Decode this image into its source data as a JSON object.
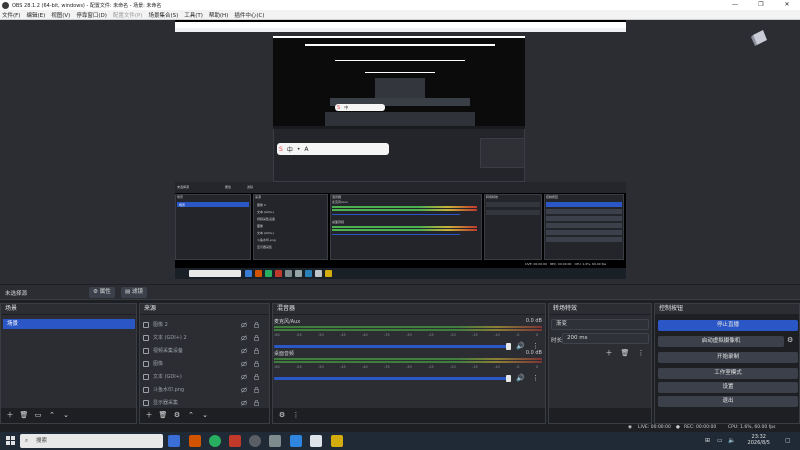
{
  "window": {
    "title": "OBS 28.1.2 (64-bit, windows) - 配置文件: 未命名 - 场景: 未命名",
    "controls": [
      "—",
      "❐",
      "✕"
    ]
  },
  "menu": [
    "文件(F)",
    "编辑(E)",
    "视图(V)",
    "停靠窗口(D)",
    "配置文件(P)",
    "场景集合(S)",
    "工具(T)",
    "帮助(H)",
    "插件中心(C)"
  ],
  "scene_bar": {
    "current": "未选择源",
    "properties": "属性",
    "filters": "滤镜"
  },
  "docks": {
    "scenes": {
      "title": "场景",
      "items": [
        "场景"
      ]
    },
    "sources": {
      "title": "来源",
      "items": [
        "图像 2",
        "文本 (GDI+) 2",
        "视频采集设备",
        "图像",
        "文本 (GDI+)",
        "斗鱼水印.png",
        "显示器采集"
      ]
    },
    "mixer": {
      "title": "混音器",
      "tracks": [
        {
          "name": "麦克风/Aux",
          "db": "0.0 dB"
        },
        {
          "name": "桌面音频",
          "db": "0.0 dB"
        }
      ],
      "ticks": [
        "-60",
        "-55",
        "-50",
        "-45",
        "-40",
        "-35",
        "-30",
        "-25",
        "-20",
        "-15",
        "-10",
        "-5",
        "0"
      ]
    },
    "transitions": {
      "title": "转场特效",
      "transition": "渐变",
      "duration_label": "时长",
      "duration": "200 ms"
    },
    "controls": {
      "title": "控制按钮",
      "buttons": [
        "停止直播",
        "启动虚拟摄像机",
        "开始录制",
        "工作室模式",
        "设置",
        "退出"
      ]
    }
  },
  "status": {
    "live": "LIVE: 00:00:00",
    "rec": "REC: 00:00:00",
    "cpu": "CPU: 1.6%, 60.00 fps"
  },
  "taskbar": {
    "search_placeholder": "搜索",
    "time": "23:32",
    "date": "2026/8/5"
  },
  "nested": {
    "ime": [
      "中",
      "•",
      "A"
    ],
    "search": "搜索"
  },
  "colors": {
    "accent": "#2a56c6",
    "panel": "#2b2d33",
    "bg": "#1e1f23"
  }
}
